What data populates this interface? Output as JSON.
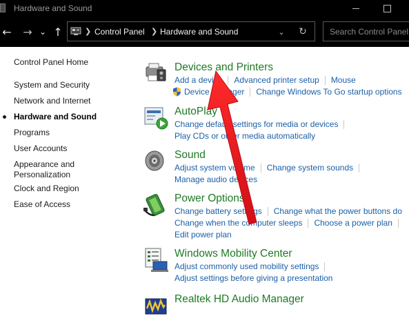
{
  "window": {
    "title": "Hardware and Sound"
  },
  "nav": {
    "back_icon": "arrow-left-icon",
    "forward_icon": "arrow-right-icon",
    "recent_icon": "chevron-down-icon",
    "up_icon": "arrow-up-icon"
  },
  "address": {
    "crumbs": [
      "Control Panel",
      "Hardware and Sound"
    ],
    "dropdown_icon": "chevron-down-icon",
    "refresh_icon": "refresh-icon"
  },
  "search": {
    "placeholder": "Search Control Panel"
  },
  "sidebar": {
    "items": [
      {
        "label": "Control Panel Home",
        "active": false
      },
      {
        "label": "System and Security",
        "active": false
      },
      {
        "label": "Network and Internet",
        "active": false
      },
      {
        "label": "Hardware and Sound",
        "active": true
      },
      {
        "label": "Programs",
        "active": false
      },
      {
        "label": "User Accounts",
        "active": false
      },
      {
        "label": "Appearance and Personalization",
        "line1": "Appearance and",
        "line2": "Personalization",
        "active": false
      },
      {
        "label": "Clock and Region",
        "active": false
      },
      {
        "label": "Ease of Access",
        "active": false
      }
    ]
  },
  "categories": [
    {
      "title": "Devices and Printers",
      "icon": "printer-icon",
      "rows": [
        [
          "Add a device",
          "Advanced printer setup",
          "Mouse"
        ],
        [
          "Device Manager",
          "Change Windows To Go startup options"
        ]
      ]
    },
    {
      "title": "AutoPlay",
      "icon": "autoplay-icon",
      "rows": [
        [
          "Change default settings for media or devices"
        ],
        [
          "Play CDs or other media automatically"
        ]
      ]
    },
    {
      "title": "Sound",
      "icon": "speaker-icon",
      "rows": [
        [
          "Adjust system volume",
          "Change system sounds"
        ],
        [
          "Manage audio devices"
        ]
      ]
    },
    {
      "title": "Power Options",
      "icon": "battery-icon",
      "rows": [
        [
          "Change battery settings",
          "Change what the power buttons do"
        ],
        [
          "Change when the computer sleeps",
          "Choose a power plan"
        ],
        [
          "Edit power plan"
        ]
      ]
    },
    {
      "title": "Windows Mobility Center",
      "icon": "mobility-center-icon",
      "rows": [
        [
          "Adjust commonly used mobility settings"
        ],
        [
          "Adjust settings before giving a presentation"
        ]
      ]
    },
    {
      "title": "Realtek HD Audio Manager",
      "icon": "realtek-audio-icon",
      "rows": []
    }
  ],
  "annotation": {
    "arrow_color": "#e8141e"
  },
  "colors": {
    "title_green": "#1e7a25",
    "link_blue": "#1a5fa8"
  }
}
